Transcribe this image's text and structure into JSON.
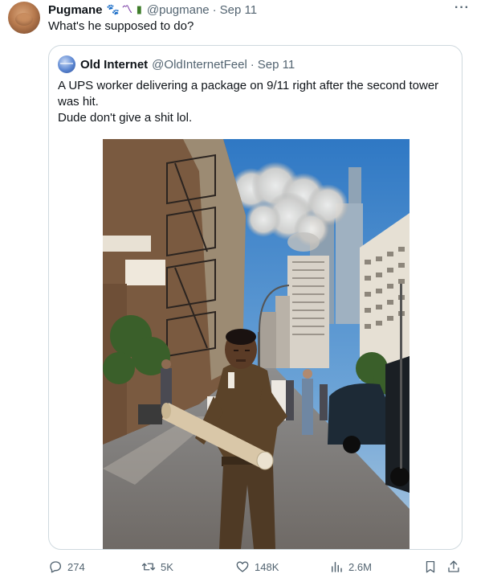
{
  "tweet": {
    "author_name": "Pugmane",
    "author_emojis": [
      "paw-prints",
      "worm",
      "can"
    ],
    "author_handle": "@pugmane",
    "separator": "·",
    "date": "Sep 11",
    "text": "What's he supposed to do?",
    "more_label": "···"
  },
  "quote": {
    "author_name": "Old Internet",
    "author_handle": "@OldInternetFeel",
    "separator": "·",
    "date": "Sep 11",
    "text_line1": "A UPS worker delivering a package on 9/11 right after the second tower was hit.",
    "text_line2": "Dude don't give a shit lol."
  },
  "actions": {
    "replies": "274",
    "retweets": "5K",
    "likes": "148K",
    "views": "2.6M"
  },
  "colors": {
    "text": "#0f1419",
    "secondary": "#536471",
    "border": "#cfd9de",
    "sky": "#3f82c8",
    "ups_brown": "#5b4329"
  }
}
